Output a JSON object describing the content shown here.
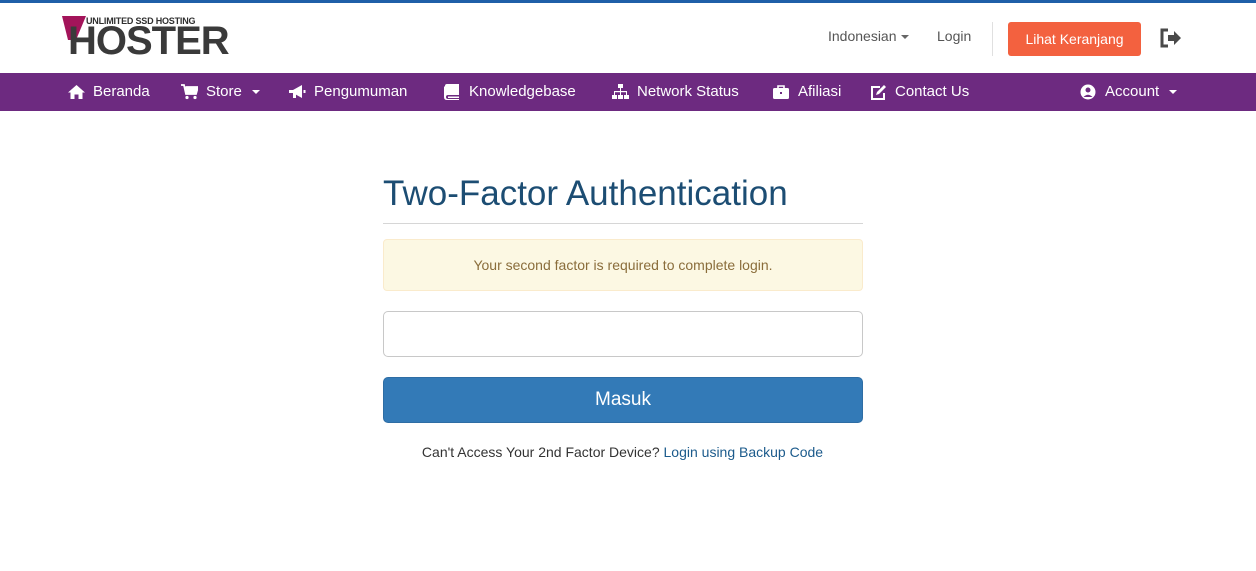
{
  "brand": {
    "logo_tagline": "UNLIMITED SSD HOSTING",
    "logo_name": "HOSTER",
    "accent_color": "#6d2a80",
    "primary_color": "#337ab7",
    "cart_color": "#f3613f"
  },
  "header": {
    "language": "Indonesian",
    "login": "Login",
    "cart": "Lihat Keranjang",
    "logout_icon": "sign-out-icon"
  },
  "nav": {
    "items": [
      {
        "label": "Beranda",
        "icon": "home-icon"
      },
      {
        "label": "Store",
        "icon": "cart-icon"
      },
      {
        "label": "Pengumuman",
        "icon": "bullhorn-icon"
      },
      {
        "label": "Knowledgebase",
        "icon": "book-icon"
      },
      {
        "label": "Network Status",
        "icon": "network-icon"
      },
      {
        "label": "Afiliasi",
        "icon": "briefcase-icon"
      },
      {
        "label": "Contact Us",
        "icon": "edit-icon"
      }
    ],
    "account": {
      "label": "Account",
      "icon": "user-circle-icon"
    }
  },
  "main": {
    "title": "Two-Factor Authentication",
    "alert": "Your second factor is required to complete login.",
    "code_input_value": "",
    "submit": "Masuk",
    "backup_prompt": "Can't Access Your 2nd Factor Device?",
    "backup_link": "Login using Backup Code"
  }
}
